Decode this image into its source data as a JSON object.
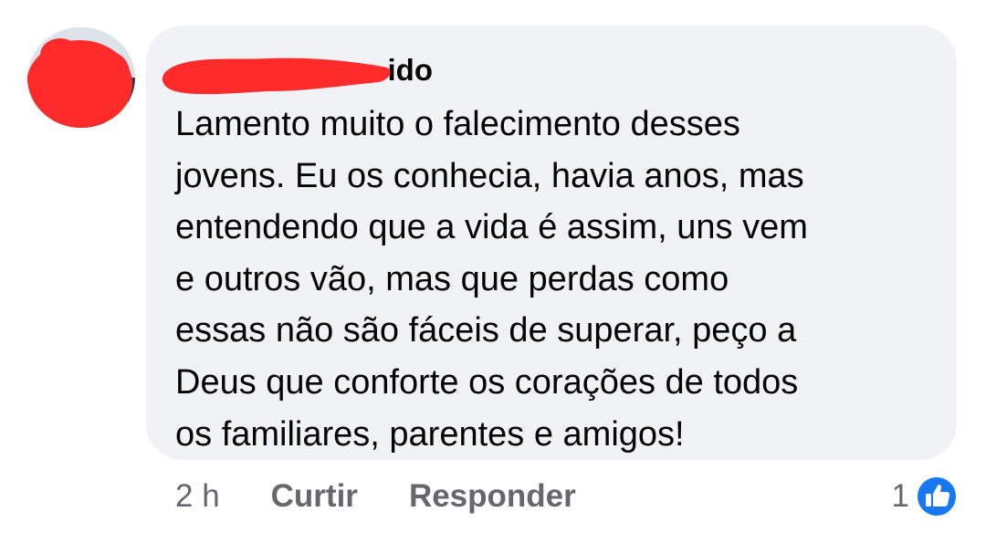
{
  "comment": {
    "author_visible": "ido",
    "text_lines": [
      "Lamento muito o falecimento desses",
      "jovens. Eu os conhecia, havia anos, mas",
      "entendendo que a vida é assim, uns vem",
      "e outros vão, mas que perdas como",
      "essas não são fáceis de superar, peço a",
      "Deus que conforte os corações de todos",
      "os familiares, parentes e amigos!"
    ]
  },
  "actions": {
    "timestamp": "2 h",
    "like_label": "Curtir",
    "reply_label": "Responder"
  },
  "reactions": {
    "count": "1",
    "icon": "like-thumbs-up-icon",
    "badge_color": "#1877f2"
  },
  "colors": {
    "bubble_bg": "#f0f2f5",
    "text": "#050505",
    "secondary_text": "#65676b",
    "redaction": "#ff2a2a"
  }
}
